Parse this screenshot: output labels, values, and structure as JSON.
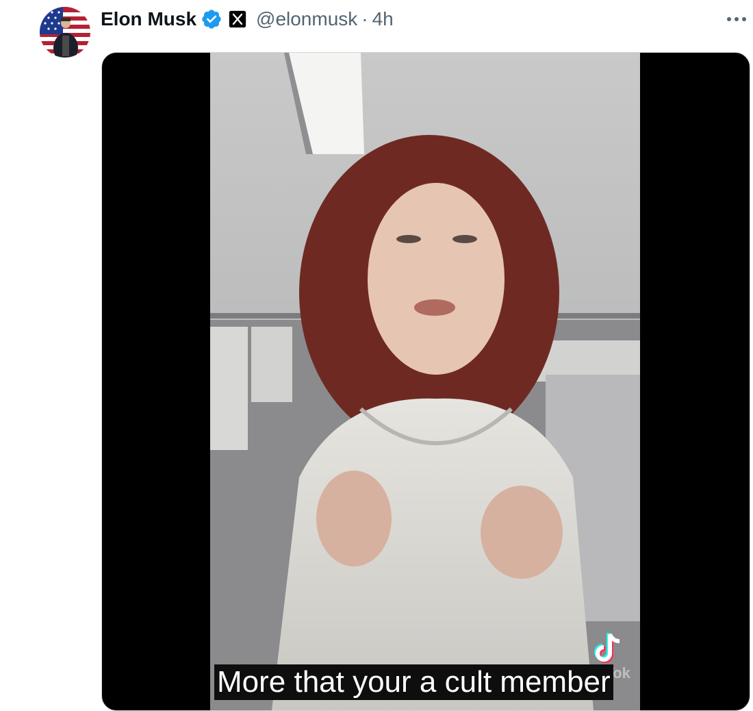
{
  "tweet": {
    "display_name": "Elon Musk",
    "handle": "@elonmusk",
    "separator": "·",
    "time": "4h"
  },
  "icons": {
    "verified": "verified-badge-icon",
    "affiliation": "x-logo-icon",
    "more": "more-options-icon",
    "watermark": "tiktok-logo-icon"
  },
  "media": {
    "caption": "More that your a cult member",
    "watermark_text": "TikTok"
  },
  "colors": {
    "verified_blue": "#1d9bf0",
    "secondary_text": "#536471",
    "primary_text": "#0f1419"
  }
}
